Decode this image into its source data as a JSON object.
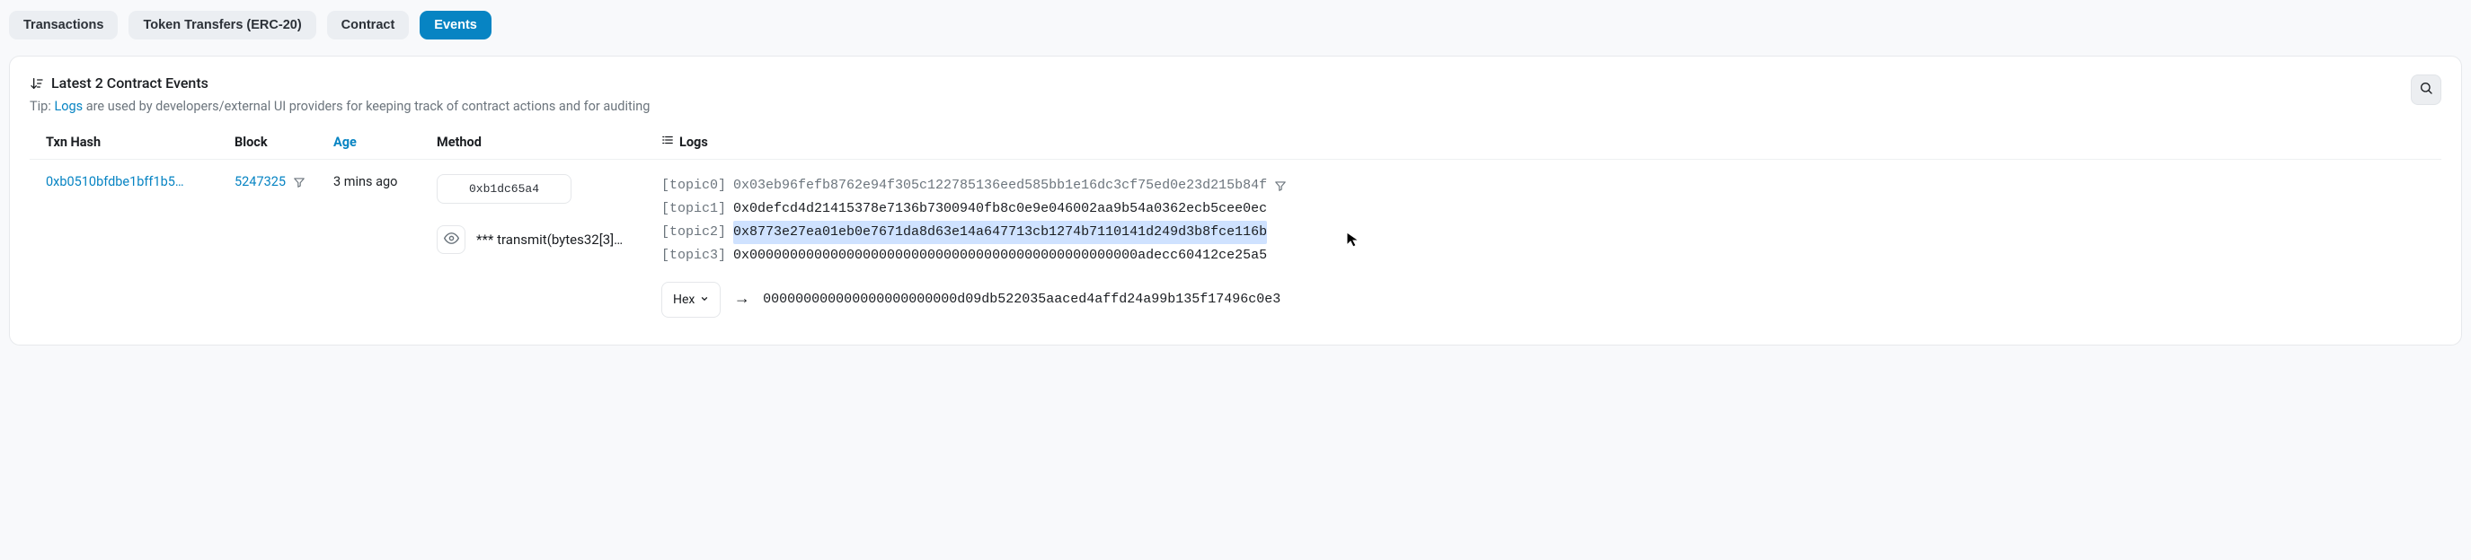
{
  "tabs": {
    "transactions": "Transactions",
    "token_transfers": "Token Transfers (ERC-20)",
    "contract": "Contract",
    "events": "Events"
  },
  "header": {
    "title": "Latest 2 Contract Events",
    "tip_prefix": "Tip: ",
    "tip_link": "Logs",
    "tip_suffix": " are used by developers/external UI providers for keeping track of contract actions and for auditing"
  },
  "columns": {
    "txn_hash": "Txn Hash",
    "block": "Block",
    "age": "Age",
    "method": "Method",
    "logs": "Logs"
  },
  "row": {
    "txn_hash": "0xb0510bfdbe1bff1b5…",
    "block": "5247325",
    "age": "3 mins ago",
    "method_id": "0xb1dc65a4",
    "method_sig": "*** transmit(bytes32[3]…",
    "topics": {
      "t0_label": "[topic0]",
      "t0_val": "0x03eb96fefb8762e94f305c122785136eed585bb1e16dc3cf75ed0e23d215b84f",
      "t1_label": "[topic1]",
      "t1_val": "0x0defcd4d21415378e7136b7300940fb8c0e9e046002aa9b54a0362ecb5cee0ec",
      "t2_label": "[topic2]",
      "t2_val": "0x8773e27ea01eb0e7671da8d63e14a647713cb1274b7110141d249d3b8fce116b",
      "t3_label": "[topic3]",
      "t3_val": "0x000000000000000000000000000000000000000000000000adecc60412ce25a5"
    },
    "data_format": "Hex",
    "data_arrow": "→",
    "data_value": "000000000000000000000000d09db522035aaced4affd24a99b135f17496c0e3"
  }
}
